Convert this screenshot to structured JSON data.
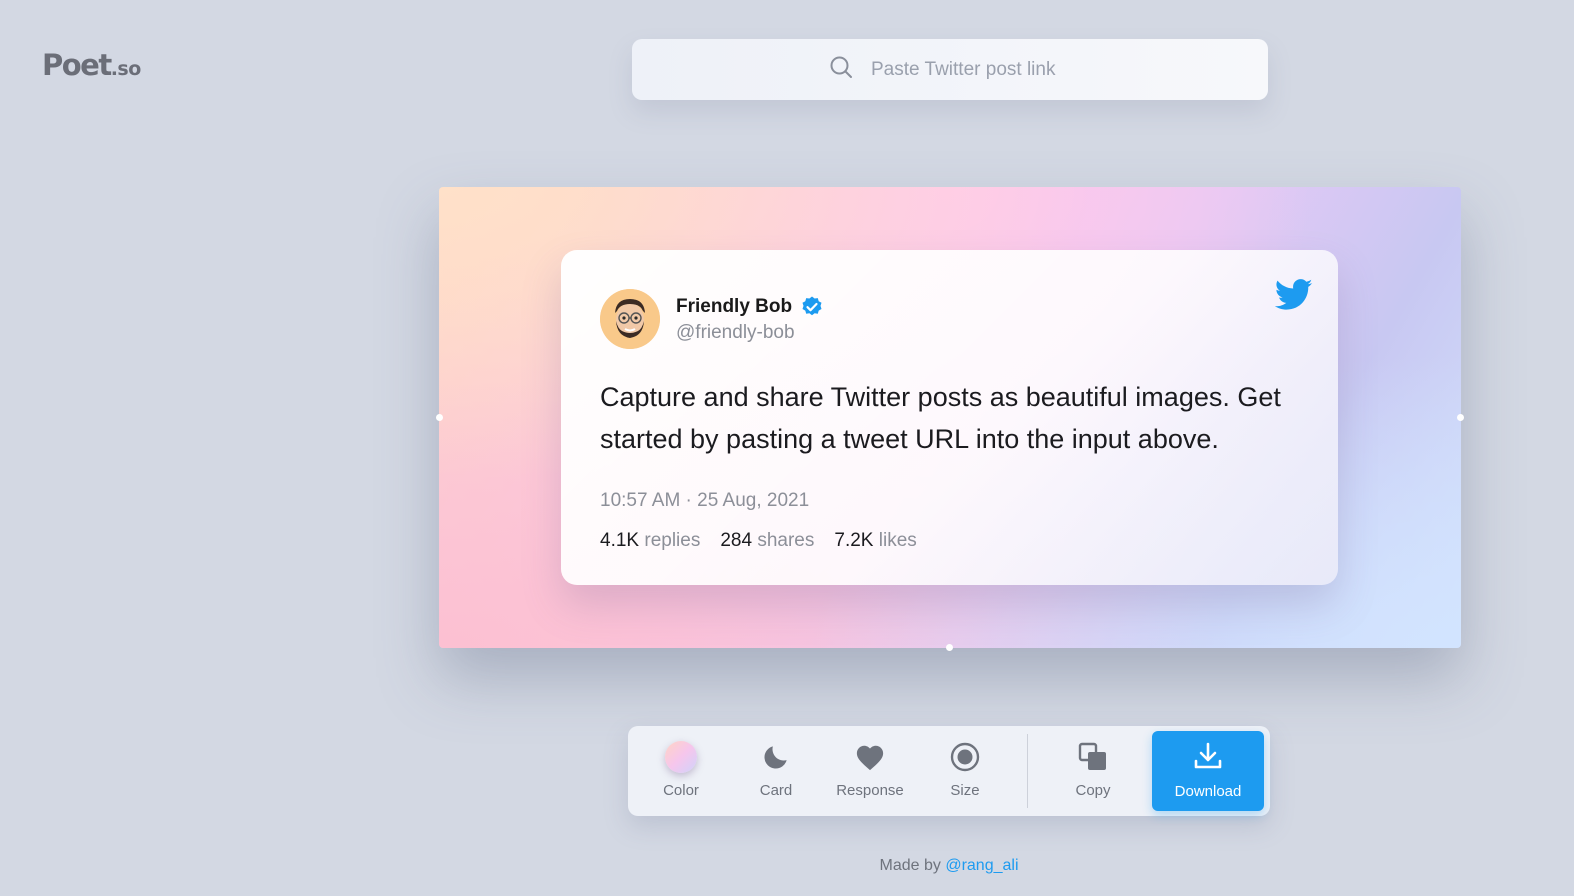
{
  "logo": {
    "main": "Poet",
    "suffix": ".so"
  },
  "search": {
    "placeholder": "Paste Twitter post link",
    "value": ""
  },
  "tweet": {
    "author_name": "Friendly Bob",
    "author_handle": "@friendly-bob",
    "verified": true,
    "text": "Capture and share Twitter posts as beautiful images. Get started by pasting a tweet URL into the input above.",
    "timestamp": "10:57 AM · 25 Aug, 2021",
    "replies_count": "4.1K",
    "replies_label": "replies",
    "shares_count": "284",
    "shares_label": "shares",
    "likes_count": "7.2K",
    "likes_label": "likes"
  },
  "toolbar": {
    "color_label": "Color",
    "card_label": "Card",
    "response_label": "Response",
    "size_label": "Size",
    "copy_label": "Copy",
    "download_label": "Download"
  },
  "footer": {
    "prefix": "Made by",
    "author_link": "@rang_ali"
  },
  "colors": {
    "accent": "#1d9bf0",
    "background": "#d3d8e3"
  }
}
